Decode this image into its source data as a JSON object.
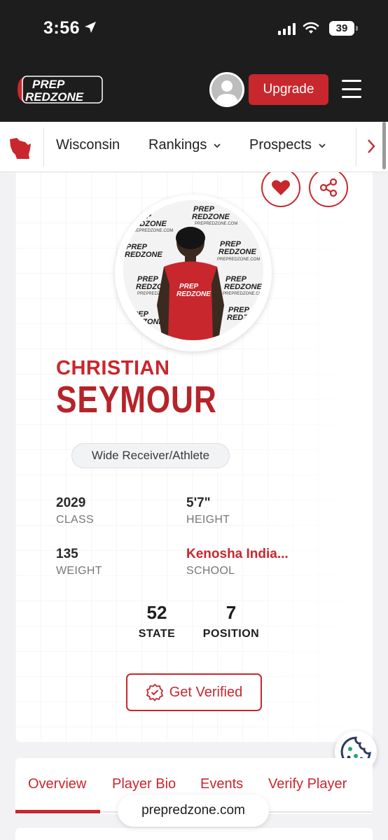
{
  "status_bar": {
    "time": "3:56",
    "battery": "39"
  },
  "header": {
    "logo_line1": "PREP",
    "logo_line2": "REDZONE",
    "upgrade_label": "Upgrade"
  },
  "nav": {
    "state_label": "Wisconsin",
    "items": [
      {
        "label": "Rankings"
      },
      {
        "label": "Prospects"
      }
    ]
  },
  "profile": {
    "first_name": "CHRISTIAN",
    "last_name": "SEYMOUR",
    "position": "Wide Receiver/Athlete",
    "stats": {
      "class_value": "2029",
      "class_label": "CLASS",
      "height_value": "5'7\"",
      "height_label": "HEIGHT",
      "weight_value": "135",
      "weight_label": "WEIGHT",
      "school_value": "Kenosha India...",
      "school_label": "SCHOOL"
    },
    "rankings": {
      "state_value": "52",
      "state_label": "STATE",
      "position_value": "7",
      "position_label": "POSITION"
    },
    "verify_label": "Get Verified",
    "photo_backdrop_text": "PREPREDZONE.COM"
  },
  "tabs": [
    {
      "label": "Overview"
    },
    {
      "label": "Player Bio"
    },
    {
      "label": "Events"
    },
    {
      "label": "Verify Player"
    }
  ],
  "browser": {
    "url": "prepredzone.com"
  },
  "colors": {
    "brand_red": "#c8272d",
    "header_dark": "#1d1d1d",
    "page_bg": "#f2f2f4",
    "cookie_teal": "#2fa37a",
    "cookie_navy": "#2b3a5c"
  },
  "icons": [
    "location-arrow-icon",
    "signal-icon",
    "wifi-icon",
    "battery-icon",
    "hamburger-menu-icon",
    "wisconsin-state-icon",
    "chevron-down-icon",
    "chevron-right-icon",
    "heart-icon",
    "share-icon",
    "verified-badge-icon",
    "cookie-icon"
  ]
}
